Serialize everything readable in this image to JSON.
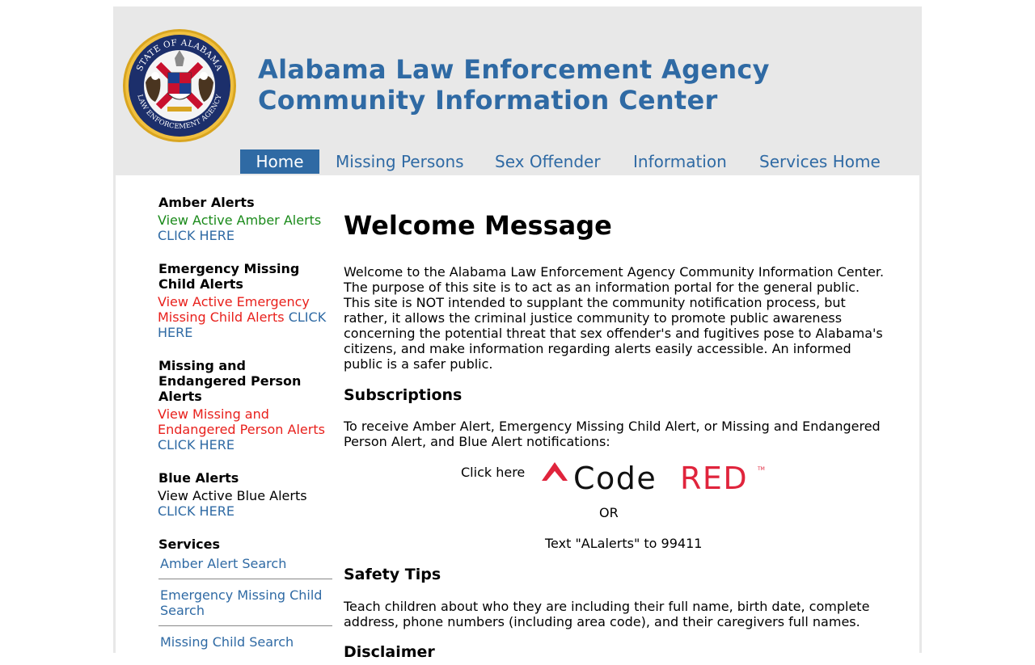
{
  "header": {
    "title_line1": "Alabama Law Enforcement Agency",
    "title_line2": "Community Information Center",
    "seal": {
      "top_text": "STATE OF ALABAMA",
      "bottom_text": "LAW ENFORCEMENT AGENCY"
    }
  },
  "nav": {
    "items": [
      {
        "label": "Home",
        "active": true
      },
      {
        "label": "Missing Persons",
        "active": false
      },
      {
        "label": "Sex Offender",
        "active": false
      },
      {
        "label": "Information",
        "active": false
      },
      {
        "label": "Services Home",
        "active": false
      }
    ]
  },
  "sidebar": {
    "amber": {
      "heading": "Amber Alerts",
      "view_text": "View Active Amber Alerts",
      "link": "CLICK HERE"
    },
    "emergency": {
      "heading": "Emergency Missing Child Alerts",
      "view_text": "View Active Emergency Missing Child Alerts",
      "link": "CLICK HERE"
    },
    "missing": {
      "heading": "Missing and Endangered Person Alerts",
      "view_text": "View Missing and Endangered Person Alerts",
      "link": "CLICK HERE"
    },
    "blue": {
      "heading": "Blue Alerts",
      "view_text": "View Active Blue Alerts",
      "link": "CLICK HERE"
    },
    "services": {
      "heading": "Services",
      "items": [
        "Amber Alert Search",
        "Emergency Missing Child Search",
        "Missing Child Search"
      ]
    }
  },
  "main": {
    "heading": "Welcome Message",
    "welcome_text": "Welcome to the Alabama Law Enforcement Agency Community Information Center. The purpose of this site is to act as an information portal for the general public. This site is NOT intended to supplant the community notification process, but rather, it allows the criminal justice community to promote public awareness concerning the potential threat that sex offender's and fugitives pose to Alabama's citizens, and make information regarding alerts easily accessible. An informed public is a safer public.",
    "subscriptions_heading": "Subscriptions",
    "subscriptions_text": "To receive Amber Alert, Emergency Missing Child Alert, or Missing and Endangered Person Alert, and Blue Alert notifications:",
    "click_here": "Click here",
    "codered_logo": {
      "code": "Code",
      "red": "RED",
      "tm": "TM"
    },
    "or": "OR",
    "text_instruction": "Text \"ALalerts\" to 99411",
    "safety_heading": "Safety Tips",
    "safety_text": "Teach children about who they are including their full name, birth date, complete address, phone numbers (including area code), and their caregivers full names.",
    "disclaimer_heading": "Disclaimer"
  },
  "colors": {
    "brand_blue": "#2f6aa4",
    "alert_red": "#e8201c",
    "amber_green": "#1a8a1a",
    "header_gray": "#e8e8e8",
    "codered_red": "#e0243c"
  }
}
